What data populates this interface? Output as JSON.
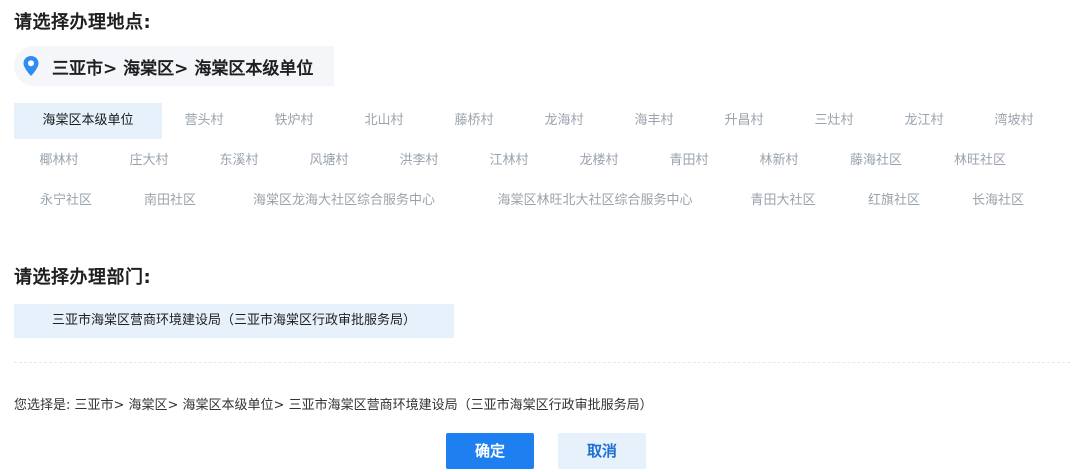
{
  "location_heading": "请选择办理地点:",
  "breadcrumb": "三亚市> 海棠区> 海棠区本级单位",
  "locations": [
    "海棠区本级单位",
    "营头村",
    "铁炉村",
    "北山村",
    "藤桥村",
    "龙海村",
    "海丰村",
    "升昌村",
    "三灶村",
    "龙江村",
    "湾坡村",
    "椰林村",
    "庄大村",
    "东溪村",
    "风塘村",
    "洪李村",
    "江林村",
    "龙楼村",
    "青田村",
    "林新村",
    "藤海社区",
    "林旺社区",
    "永宁社区",
    "南田社区",
    "海棠区龙海大社区综合服务中心",
    "海棠区林旺北大社区综合服务中心",
    "青田大社区",
    "红旗社区",
    "长海社区"
  ],
  "selected_location": "海棠区本级单位",
  "department_heading": "请选择办理部门:",
  "department": "三亚市海棠区营商环境建设局（三亚市海棠区行政审批服务局）",
  "summary": "您选择是:  三亚市> 海棠区> 海棠区本级单位> 三亚市海棠区营商环境建设局（三亚市海棠区行政审批服务局）",
  "buttons": {
    "confirm": "确定",
    "cancel": "取消"
  },
  "colors": {
    "accent": "#1e7ff0",
    "selected_bg": "#e6f1fc",
    "muted_text": "#9aa3ad"
  }
}
